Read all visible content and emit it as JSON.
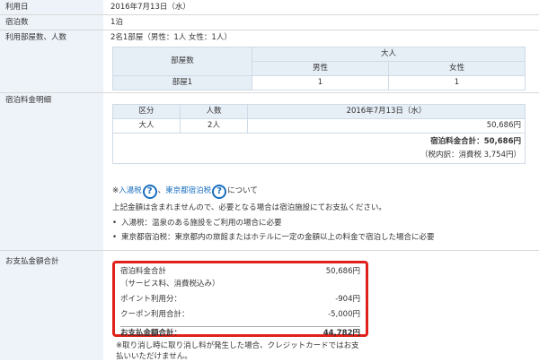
{
  "rows": {
    "use_date": {
      "label": "利用日",
      "value": "2016年7月13日（水）"
    },
    "nights": {
      "label": "宿泊数",
      "value": "1泊"
    },
    "rooms": {
      "label": "利用部屋数、人数",
      "value": "2名1部屋（男性：1人 女性：1人）",
      "table": {
        "col_room": "部屋数",
        "col_adult": "大人",
        "col_male": "男性",
        "col_female": "女性",
        "room_label": "部屋1",
        "male": "1",
        "female": "1"
      }
    },
    "breakdown": {
      "label": "宿泊料金明細",
      "table": {
        "col_type": "区分",
        "col_people": "人数",
        "col_date": "2016年7月13日（水）",
        "type": "大人",
        "people": "2人",
        "price": "50,686円"
      },
      "total_label": "宿泊料金合計：",
      "total_value": "50,686円",
      "tax_note": "（税内訳：消費税 3,754円）",
      "tax_prefix": "※",
      "bath_tax": "入湯税",
      "separator": "、",
      "tokyo_tax": "東京都宿泊税",
      "tax_suffix": "について",
      "not_included": "上記金額は含まれませんので、必要となる場合は宿泊施設にてお支払ください。",
      "bullets": [
        "入湯税：温泉のある施設をご利用の場合に必要",
        "東京都宿泊税：東京都内の旅館またはホテルに一定の金額以上の料金で宿泊した場合に必要"
      ]
    },
    "payment": {
      "label": "お支払金額合計",
      "lines": [
        {
          "name": "宿泊料金合計",
          "value": "50,686円"
        },
        {
          "name": "（サービス料、消費税込み）",
          "value": ""
        },
        {
          "name": "ポイント利用分：",
          "value": "-904円"
        },
        {
          "name": "クーポン利用合計：",
          "value": "-5,000円"
        }
      ],
      "total_name": "お支払金額合計：",
      "total_value": "44,782円",
      "cancel_note": "※取り消し時に取り消し料が発生した場合、クレジットカードではお支払いいただけません。"
    }
  },
  "icons": {
    "help": "?"
  },
  "colors": {
    "label_bg": "#eef3f9",
    "link": "#1a6fc0",
    "highlight": "#e0201a"
  }
}
